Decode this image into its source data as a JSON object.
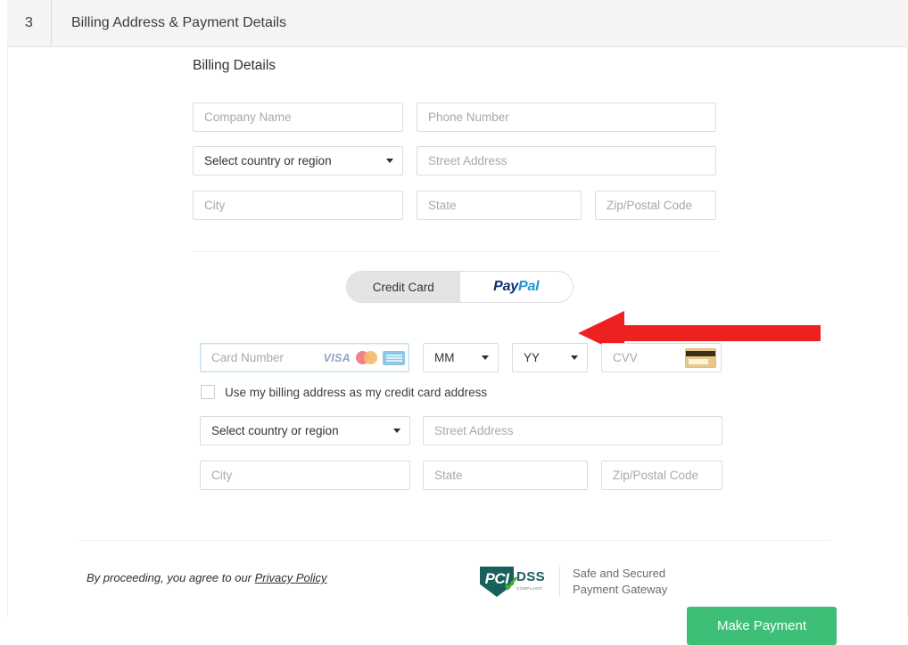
{
  "step": {
    "number": "3",
    "title": "Billing Address & Payment Details"
  },
  "billing": {
    "section_title": "Billing Details",
    "company_placeholder": "Company Name",
    "phone_placeholder": "Phone Number",
    "country_value": "Select country or region",
    "street_placeholder": "Street Address",
    "city_placeholder": "City",
    "state_placeholder": "State",
    "zip_placeholder": "Zip/Postal Code"
  },
  "payment_toggle": {
    "credit_card_label": "Credit Card",
    "paypal_label_part1": "Pay",
    "paypal_label_part2": "Pal",
    "selected": "Credit Card"
  },
  "card": {
    "number_placeholder": "Card Number",
    "brands": [
      "visa",
      "mastercard",
      "amex"
    ],
    "visa_label": "VISA",
    "month_value": "MM",
    "year_value": "YY",
    "cvv_placeholder": "CVV"
  },
  "card_address": {
    "same_as_billing_label": "Use my billing address as my credit card address",
    "checked": false,
    "country_value": "Select country or region",
    "street_placeholder": "Street Address",
    "city_placeholder": "City",
    "state_placeholder": "State",
    "zip_placeholder": "Zip/Postal Code"
  },
  "footer": {
    "legal_prefix": "By proceeding, you agree to our ",
    "privacy_policy_label": "Privacy Policy",
    "pci_shield_label": "PCI",
    "pci_dss_label": "DSS",
    "pci_compliant_label": "COMPLIANT",
    "secure_line1": "Safe and Secured",
    "secure_line2": "Payment Gateway",
    "pay_button_label": "Make Payment"
  },
  "annotation": {
    "arrow_color": "#ee2121",
    "arrow_direction": "left",
    "points_at": "paypal-toggle-option"
  },
  "colors": {
    "accent_green": "#3dbf78",
    "paypal_dark": "#12306e",
    "paypal_light": "#199ad6",
    "pci_teal": "#18605c",
    "pci_check_green": "#43ad3a",
    "header_bg": "#f4f4f5",
    "toggle_active_bg": "#e4e4e6"
  }
}
